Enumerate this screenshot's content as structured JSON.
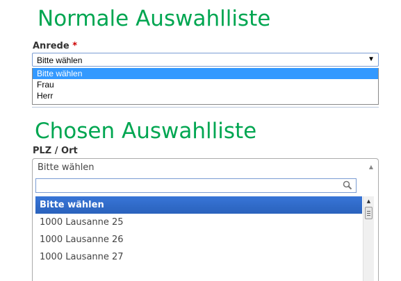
{
  "section1": {
    "title": "Normale Auswahlliste",
    "label": "Anrede",
    "required_marker": "*",
    "select": {
      "value": "Bitte wählen",
      "options": [
        "Bitte wählen",
        "Frau",
        "Herr"
      ]
    }
  },
  "section2": {
    "title": "Chosen Auswahlliste",
    "label": "PLZ / Ort",
    "select": {
      "value": "Bitte wählen",
      "search_value": "",
      "results": [
        "Bitte wählen",
        "1000 Lausanne 25",
        "1000 Lausanne 26",
        "1000 Lausanne 27"
      ]
    }
  },
  "colors": {
    "heading": "#00a651",
    "native_highlight": "#3399ff",
    "chosen_highlight": "#3875d7",
    "required": "#cc0000"
  },
  "icons": [
    "dropdown-arrow-icon",
    "chevron-up-icon",
    "search-icon",
    "scroll-up-icon"
  ]
}
